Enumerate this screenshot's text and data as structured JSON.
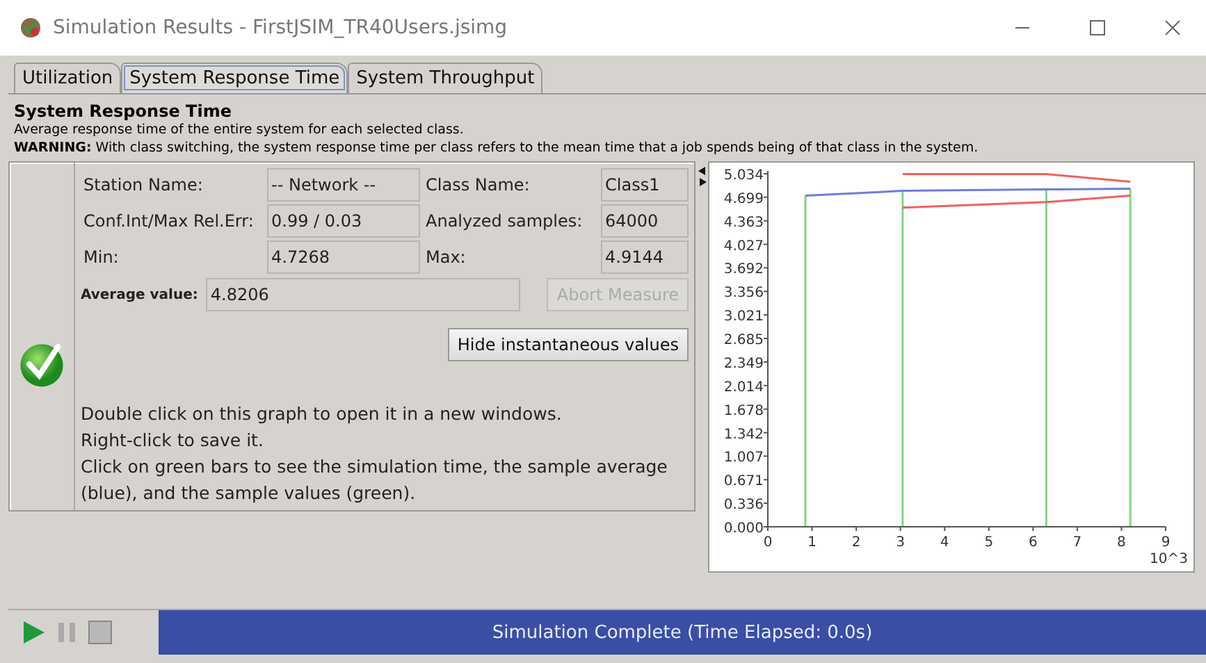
{
  "window": {
    "title": "Simulation Results - FirstJSIM_TR40Users.jsimg"
  },
  "tabs": [
    {
      "label": "Utilization",
      "selected": false
    },
    {
      "label": "System Response Time",
      "selected": true
    },
    {
      "label": "System Throughput",
      "selected": false
    }
  ],
  "header": {
    "title": "System Response Time",
    "description": "Average response time of the entire system for each selected class.",
    "warning": "**WARNING:** With class switching, the system response time per class refers to the mean time that a job spends being of that class in the system."
  },
  "fields": [
    {
      "label": "Station Name:",
      "value": "-- Network --"
    },
    {
      "label": "Class Name:",
      "value": "Class1"
    },
    {
      "label": "Conf.Int/Max Rel.Err:",
      "value": "0.99 / 0.03"
    },
    {
      "label": "Analyzed samples:",
      "value": "64000"
    },
    {
      "label": "Min:",
      "value": "4.7268"
    },
    {
      "label": "Max:",
      "value": "4.9144"
    }
  ],
  "average": {
    "label": "Average value:",
    "value": "4.8206"
  },
  "abort_button": {
    "label": "Abort Measure",
    "disabled": true
  },
  "hide_button": {
    "label": "Hide instantaneous values"
  },
  "hints": [
    "Double click on this graph to open it in a new windows.",
    "Right-click to save it.",
    "Click on green bars to see the simulation time, the sample average (blue), and the sample values (green)."
  ],
  "chart_data": {
    "type": "line",
    "xlabel": "10^3",
    "xlim": [
      0,
      9
    ],
    "ylim": [
      0,
      5.034
    ],
    "xticks": [
      0,
      1,
      2,
      3,
      4,
      5,
      6,
      7,
      8,
      9
    ],
    "yticks": [
      {
        "value": 0,
        "label": "0.000"
      },
      {
        "value": 0.336,
        "label": "0.336"
      },
      {
        "value": 0.671,
        "label": "0.671"
      },
      {
        "value": 1.007,
        "label": "1.007"
      },
      {
        "value": 1.342,
        "label": "1.342"
      },
      {
        "value": 1.678,
        "label": "1.678"
      },
      {
        "value": 2.014,
        "label": "2.014"
      },
      {
        "value": 2.349,
        "label": "2.349"
      },
      {
        "value": 2.685,
        "label": "2.685"
      },
      {
        "value": 3.021,
        "label": "3.021"
      },
      {
        "value": 3.356,
        "label": "3.356"
      },
      {
        "value": 3.692,
        "label": "3.692"
      },
      {
        "value": 4.027,
        "label": "4.027"
      },
      {
        "value": 4.363,
        "label": "4.363"
      },
      {
        "value": 4.699,
        "label": "4.699"
      },
      {
        "value": 5.034,
        "label": "5.034"
      }
    ],
    "x": [
      0.85,
      3.05,
      6.3,
      8.2
    ],
    "series": [
      {
        "color": "#6a7fd8",
        "values": [
          4.72,
          4.79,
          4.81,
          4.82
        ]
      },
      {
        "color": "#f06060",
        "values": [
          null,
          5.03,
          5.03,
          4.92
        ]
      },
      {
        "color": "#f06060",
        "values": [
          null,
          4.55,
          4.63,
          4.72
        ]
      }
    ],
    "ref_lines": [
      {
        "axis": "x",
        "value": 0.85,
        "color": "#80d880"
      },
      {
        "axis": "x",
        "value": 3.05,
        "color": "#80d880"
      },
      {
        "axis": "x",
        "value": 6.3,
        "color": "#80d880"
      },
      {
        "axis": "x",
        "value": 8.2,
        "color": "#80d880"
      }
    ]
  },
  "toolbar": [
    {
      "kind": "play",
      "disabled": false
    },
    {
      "kind": "pause",
      "disabled": true
    },
    {
      "kind": "stop",
      "disabled": true
    }
  ],
  "status_bar": {
    "text": "Simulation Complete (Time Elapsed: 0.0s)"
  }
}
